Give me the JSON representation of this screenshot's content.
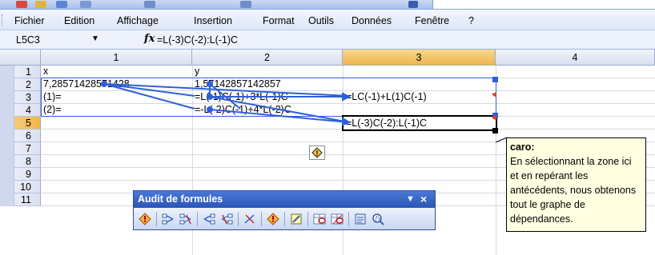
{
  "menu": {
    "items": [
      "Fichier",
      "Edition",
      "Affichage",
      "Insertion",
      "Format",
      "Outils",
      "Données",
      "Fenêtre",
      "?"
    ]
  },
  "formula_bar": {
    "name_box": "L5C3",
    "fx_symbol": "fx",
    "formula": "=L(-3)C(-2):L(-1)C"
  },
  "sheet": {
    "columns": [
      "1",
      "2",
      "3",
      "4"
    ],
    "rows": [
      "1",
      "2",
      "3",
      "4",
      "5",
      "6",
      "7",
      "8",
      "9",
      "10",
      "11"
    ],
    "cells": {
      "r1c1": "x",
      "r1c2": "y",
      "r2c1": "7,28571428571428",
      "r2c2": "1,57142857142857",
      "r3c1": "(1)=",
      "r3c2": "=L(-1)C(-1)+3*L(-1)C",
      "r3c3": "=LC(-1)+L(1)C(-1)",
      "r4c1": "(2)=",
      "r4c2": "=-L(-2)C(-1)+4*L(-2)C",
      "r5c3": "=L(-3)C(-2):L(-1)C"
    },
    "active_cell": "L5C3"
  },
  "comment": {
    "author": "caro:",
    "text": "En sélectionnant la zone ici et en repérant les antécédents, nous obtenons tout le graphe de dépendances."
  },
  "audit_toolbar": {
    "title": "Audit de formules",
    "dropdown": "▼",
    "close": "×",
    "buttons": [
      "error-check-icon",
      "trace-precedents-icon",
      "remove-precedent-arrows-icon",
      "trace-dependents-icon",
      "remove-dependent-arrows-icon",
      "remove-all-arrows-icon",
      "trace-error-icon",
      "new-comment-icon",
      "circle-invalid-data-icon",
      "clear-validation-circles-icon",
      "watch-window-icon",
      "evaluate-formula-icon"
    ]
  },
  "colors": {
    "tracer_blue": "#2f5fd9",
    "active_header": "#f0b54e",
    "titlebar_blue": "#2a55b8",
    "comment_bg": "#ffffe1"
  }
}
